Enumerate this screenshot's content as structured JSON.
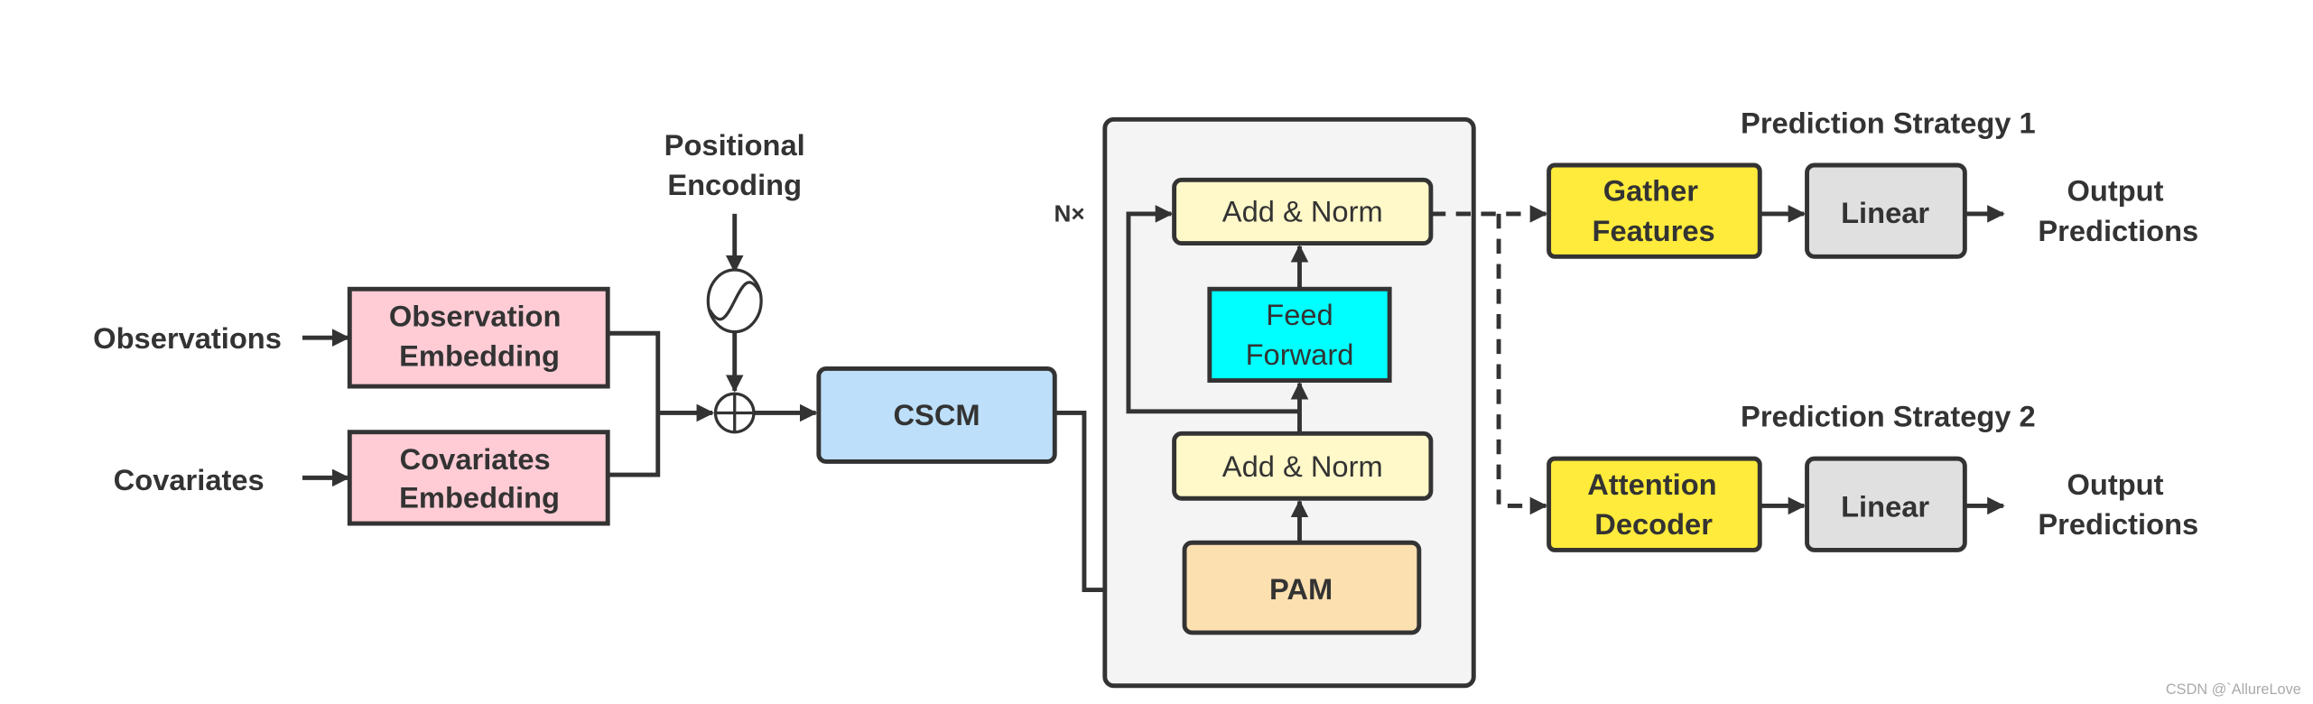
{
  "inputs": {
    "observations": "Observations",
    "covariates": "Covariates"
  },
  "positional_encoding": [
    "Positional",
    "Encoding"
  ],
  "observation_embedding": [
    "Observation",
    "Embedding"
  ],
  "covariates_embedding": [
    "Covariates",
    "Embedding"
  ],
  "cscm": "CSCM",
  "encoder": {
    "repeat": "N×",
    "add_norm_top": "Add & Norm",
    "feed_forward": [
      "Feed",
      "Forward"
    ],
    "add_norm_bottom": "Add & Norm",
    "pam": "PAM"
  },
  "strategy1": {
    "title": "Prediction Strategy 1",
    "block": [
      "Gather",
      "Features"
    ],
    "linear": "Linear",
    "output": [
      "Output",
      "Predictions"
    ]
  },
  "strategy2": {
    "title": "Prediction Strategy 2",
    "block": [
      "Attention",
      "Decoder"
    ],
    "linear": "Linear",
    "output": [
      "Output",
      "Predictions"
    ]
  },
  "watermark": "CSDN @`AllureLove",
  "colors": {
    "embedding": "#ffccd5",
    "cscm": "#bddff9",
    "container": "#f4f4f4",
    "add_norm": "#fff8c8",
    "feed_forward": "#00ffff",
    "pam": "#fde0b0",
    "strategy_block": "#ffeb3b",
    "linear": "#e0e0e0"
  }
}
